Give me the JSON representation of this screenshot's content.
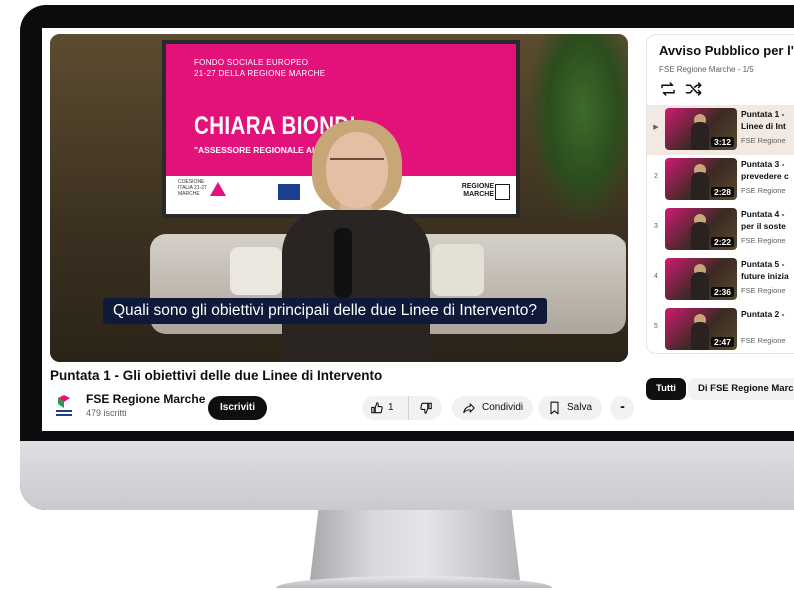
{
  "video": {
    "screen_lines": [
      "FONDO SOCIALE EUROPEO",
      "21-27 DELLA REGIONE MARCHE"
    ],
    "screen_name": "CHIARA BIONDI",
    "screen_role": "\"ASSESSORE REGIONALE AL",
    "logos": {
      "coesione": [
        "COESIONE",
        "ITALIA 21-27",
        "MARCHE"
      ],
      "regione": [
        "REGIONE",
        "MARCHE"
      ]
    },
    "subtitle": "Quali sono gli obiettivi principali delle due Linee di Intervento?"
  },
  "title": "Puntata 1 - Gli obiettivi delle due Linee di Intervento",
  "channel": {
    "name": "FSE Regione Marche",
    "subscribers": "479 iscritti"
  },
  "actions": {
    "subscribe": "Iscriviti",
    "likes": "1",
    "share": "Condividi",
    "save": "Salva",
    "more": "•••"
  },
  "playlist": {
    "title": "Avviso Pubblico per l'",
    "subtitle": "FSE Regione Marche - 1/5",
    "items": [
      {
        "index": "▶",
        "duration": "3:12",
        "line1": "Puntata 1 -",
        "line2": "Linee di Int",
        "channel": "FSE Regione"
      },
      {
        "index": "2",
        "duration": "2:28",
        "line1": "Puntata 3 -",
        "line2": "prevedere c",
        "channel": "FSE Regione"
      },
      {
        "index": "3",
        "duration": "2:22",
        "line1": "Puntata 4 -",
        "line2": "per il soste",
        "channel": "FSE Regione"
      },
      {
        "index": "4",
        "duration": "2:36",
        "line1": "Puntata 5 -",
        "line2": "future inizia",
        "channel": "FSE Regione"
      },
      {
        "index": "5",
        "duration": "2:47",
        "line1": "Puntata 2 -",
        "line2": "",
        "channel": "FSE Regione"
      }
    ]
  },
  "chips": [
    "Tutti",
    "Di FSE Regione Marc"
  ]
}
